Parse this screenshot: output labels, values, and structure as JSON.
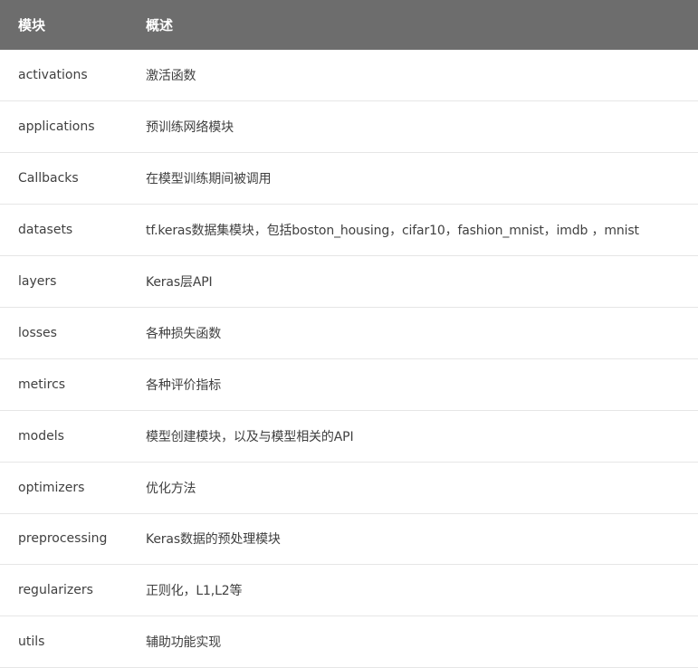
{
  "table": {
    "headers": {
      "module": "模块",
      "description": "概述"
    },
    "rows": [
      {
        "module": "activations",
        "description": "激活函数"
      },
      {
        "module": "applications",
        "description": "预训练网络模块"
      },
      {
        "module": "Callbacks",
        "description": "在模型训练期间被调用"
      },
      {
        "module": "datasets",
        "description": "tf.keras数据集模块，包括boston_housing，cifar10，fashion_mnist，imdb ，mnist"
      },
      {
        "module": "layers",
        "description": "Keras层API"
      },
      {
        "module": "losses",
        "description": "各种损失函数"
      },
      {
        "module": "metircs",
        "description": "各种评价指标"
      },
      {
        "module": "models",
        "description": "模型创建模块，以及与模型相关的API"
      },
      {
        "module": "optimizers",
        "description": "优化方法"
      },
      {
        "module": "preprocessing",
        "description": "Keras数据的预处理模块"
      },
      {
        "module": "regularizers",
        "description": "正则化，L1,L2等"
      },
      {
        "module": "utils",
        "description": "辅助功能实现"
      }
    ]
  },
  "colors": {
    "header_background": "#6d6d6d",
    "header_text": "#ffffff",
    "body_text": "#404040",
    "row_divider": "#e6e6e6"
  }
}
